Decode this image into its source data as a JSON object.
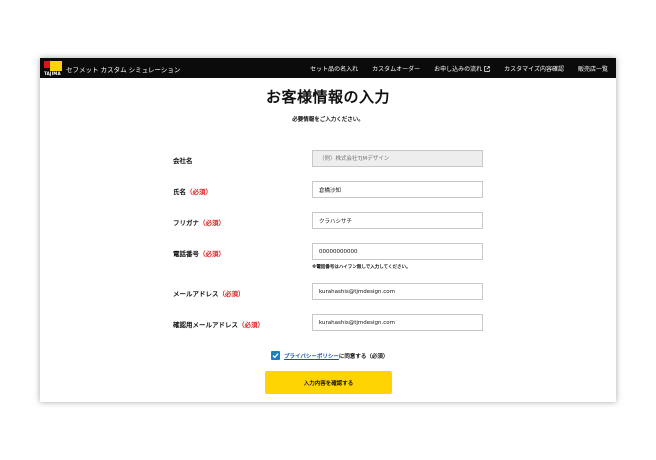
{
  "header": {
    "logo_text": "TAJIMA",
    "app_title": "セフメット カスタム シミュレーション",
    "nav": [
      "セット品の名入れ",
      "カスタムオーダー",
      "お申し込みの流れ",
      "カスタマイズ内容確認",
      "販売店一覧"
    ],
    "external_icon": "external-link-icon"
  },
  "page": {
    "title": "お客様情報の入力",
    "subtitle": "必要情報をご入力ください。"
  },
  "form": {
    "required_mark": "（必須）",
    "company": {
      "label": "会社名",
      "value": "",
      "placeholder": "（例）株式会社TJMデザイン"
    },
    "name": {
      "label": "氏名",
      "value": "倉橋沙知"
    },
    "furigana": {
      "label": "フリガナ",
      "value": "クラハシサチ"
    },
    "phone": {
      "label": "電話番号",
      "value": "00000000000",
      "note": "※電話番号はハイフン無しで入力してください。"
    },
    "email": {
      "label": "メールアドレス",
      "value": "kurahashis@tjmdesign.com"
    },
    "email_confirm": {
      "label": "確認用メールアドレス",
      "value": "kurahashis@tjmdesign.com"
    },
    "agree": {
      "checked": true,
      "link": "プライバシーポリシー",
      "rest": "に同意する（必須）"
    },
    "submit_label": "入力内容を確認する"
  },
  "colors": {
    "accent_yellow": "#ffd400",
    "required_red": "#e02020",
    "checkbox_blue": "#1e7fc3",
    "header_black": "#0b0b0b"
  }
}
